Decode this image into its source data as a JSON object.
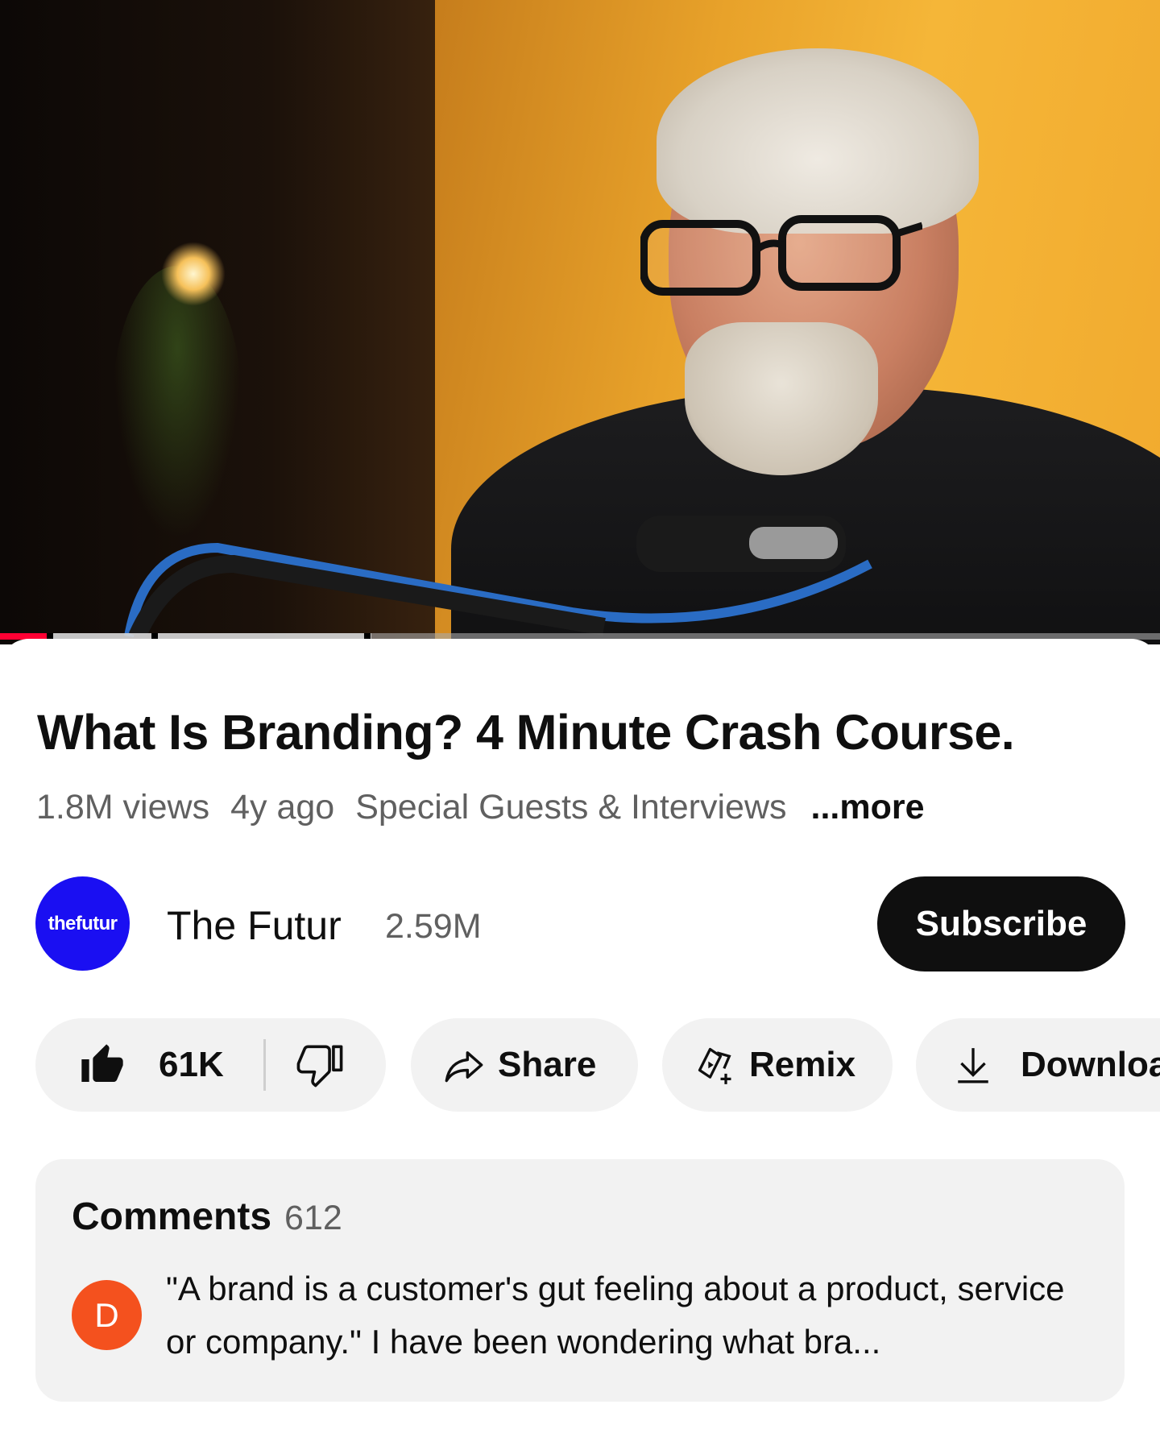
{
  "video": {
    "progress_played": 0.04,
    "progress_buffered": 0.32
  },
  "video_info": {
    "title": "What Is Branding? 4 Minute Crash Course.",
    "views": "1.8M views",
    "age": "4y ago",
    "playlist": "Special Guests & Interviews",
    "more_label": "...more"
  },
  "channel": {
    "avatar_text": "thefutur",
    "name": "The Futur",
    "subscribers": "2.59M",
    "subscribe_label": "Subscribe",
    "avatar_color": "#1a0ff2"
  },
  "actions": {
    "like_count": "61K",
    "share_label": "Share",
    "remix_label": "Remix",
    "download_label": "Downloa"
  },
  "comments": {
    "title": "Comments",
    "count": "612",
    "top_comment": {
      "avatar_letter": "D",
      "avatar_color": "#f4511e",
      "text": "\"A brand is a customer's gut feeling about a product, service or company.\" I have been wondering what bra..."
    }
  },
  "colors": {
    "accent_red": "#ff0033",
    "pill_bg": "#f2f2f2",
    "subscribe_bg": "#0f0f0f"
  }
}
